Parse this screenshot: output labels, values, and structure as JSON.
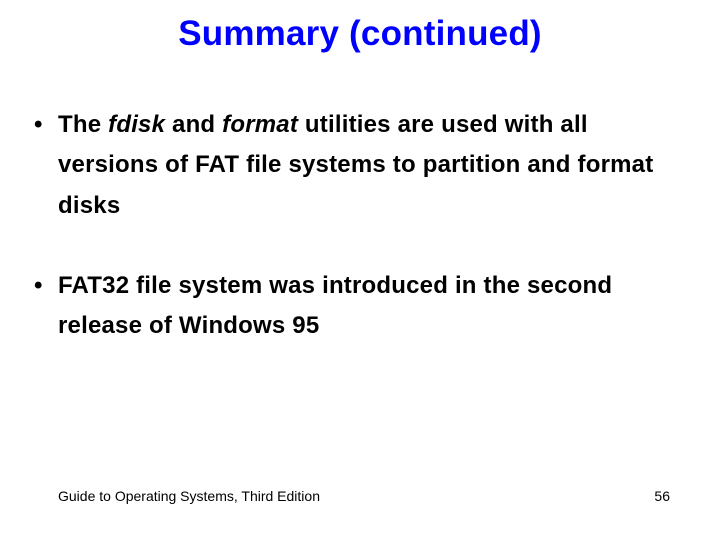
{
  "title": "Summary (continued)",
  "bullets": [
    {
      "runs": [
        {
          "text": "The ",
          "italic": false
        },
        {
          "text": "fdisk",
          "italic": true
        },
        {
          "text": " and ",
          "italic": false
        },
        {
          "text": "format",
          "italic": true
        },
        {
          "text": " utilities are used with all versions of FAT file systems to partition and format disks",
          "italic": false
        }
      ]
    },
    {
      "runs": [
        {
          "text": "FAT32 file system was introduced in the second release of Windows 95",
          "italic": false
        }
      ]
    }
  ],
  "footer": {
    "left": "Guide to Operating Systems, Third Edition",
    "page": "56"
  }
}
